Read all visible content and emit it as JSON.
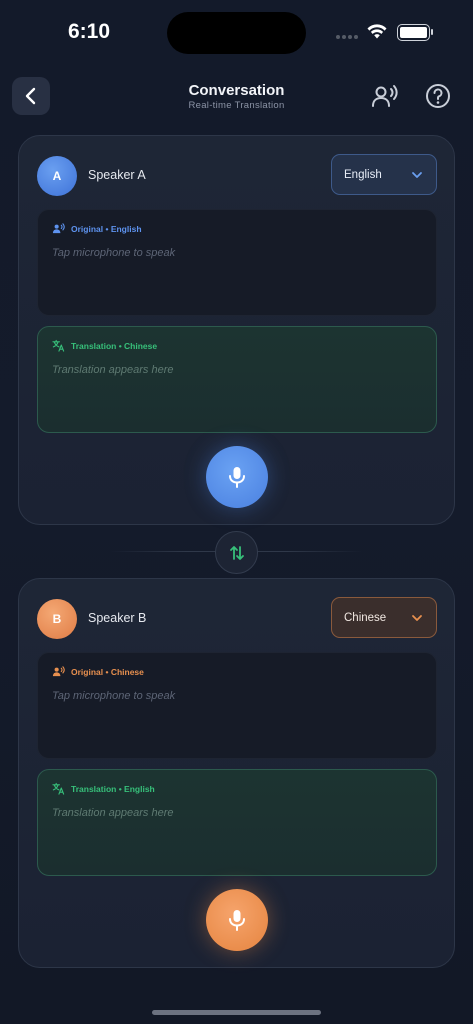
{
  "status_bar": {
    "time": "6:10"
  },
  "header": {
    "title": "Conversation",
    "subtitle": "Real-time Translation"
  },
  "speaker_a": {
    "avatar_letter": "A",
    "name": "Speaker A",
    "language": "English",
    "original_label": "Original • English",
    "original_placeholder": "Tap microphone to speak",
    "translation_label": "Translation • Chinese",
    "translation_placeholder": "Translation appears here"
  },
  "speaker_b": {
    "avatar_letter": "B",
    "name": "Speaker B",
    "language": "Chinese",
    "original_label": "Original • Chinese",
    "original_placeholder": "Tap microphone to speak",
    "translation_label": "Translation • English",
    "translation_placeholder": "Translation appears here"
  },
  "colors": {
    "accent_blue": "#4a80e0",
    "accent_orange": "#e5843f",
    "accent_green": "#37c07a",
    "background": "#131a2a"
  },
  "icons": {
    "back": "chevron-left-icon",
    "speaker_mode": "person-voice-icon",
    "help": "question-circle-icon",
    "swap": "swap-vertical-icon",
    "mic": "microphone-icon",
    "translate": "translate-icon"
  }
}
